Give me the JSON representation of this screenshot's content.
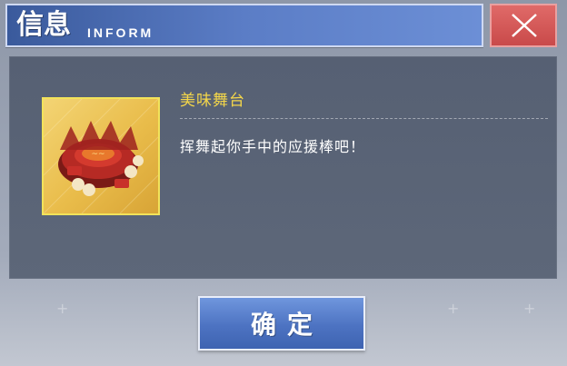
{
  "header": {
    "title": "信息",
    "subtitle": "INFORM",
    "close_icon": "close-icon"
  },
  "item": {
    "icon": "food-stage-icon",
    "name": "美味舞台",
    "description": "挥舞起你手中的应援棒吧！"
  },
  "actions": {
    "confirm_label": "确定"
  },
  "colors": {
    "title_bar": "#5b7dc6",
    "close_button": "#d65a59",
    "item_name": "#f3d64a",
    "item_frame": "#f2e35a",
    "confirm_button": "#5a80cf"
  }
}
